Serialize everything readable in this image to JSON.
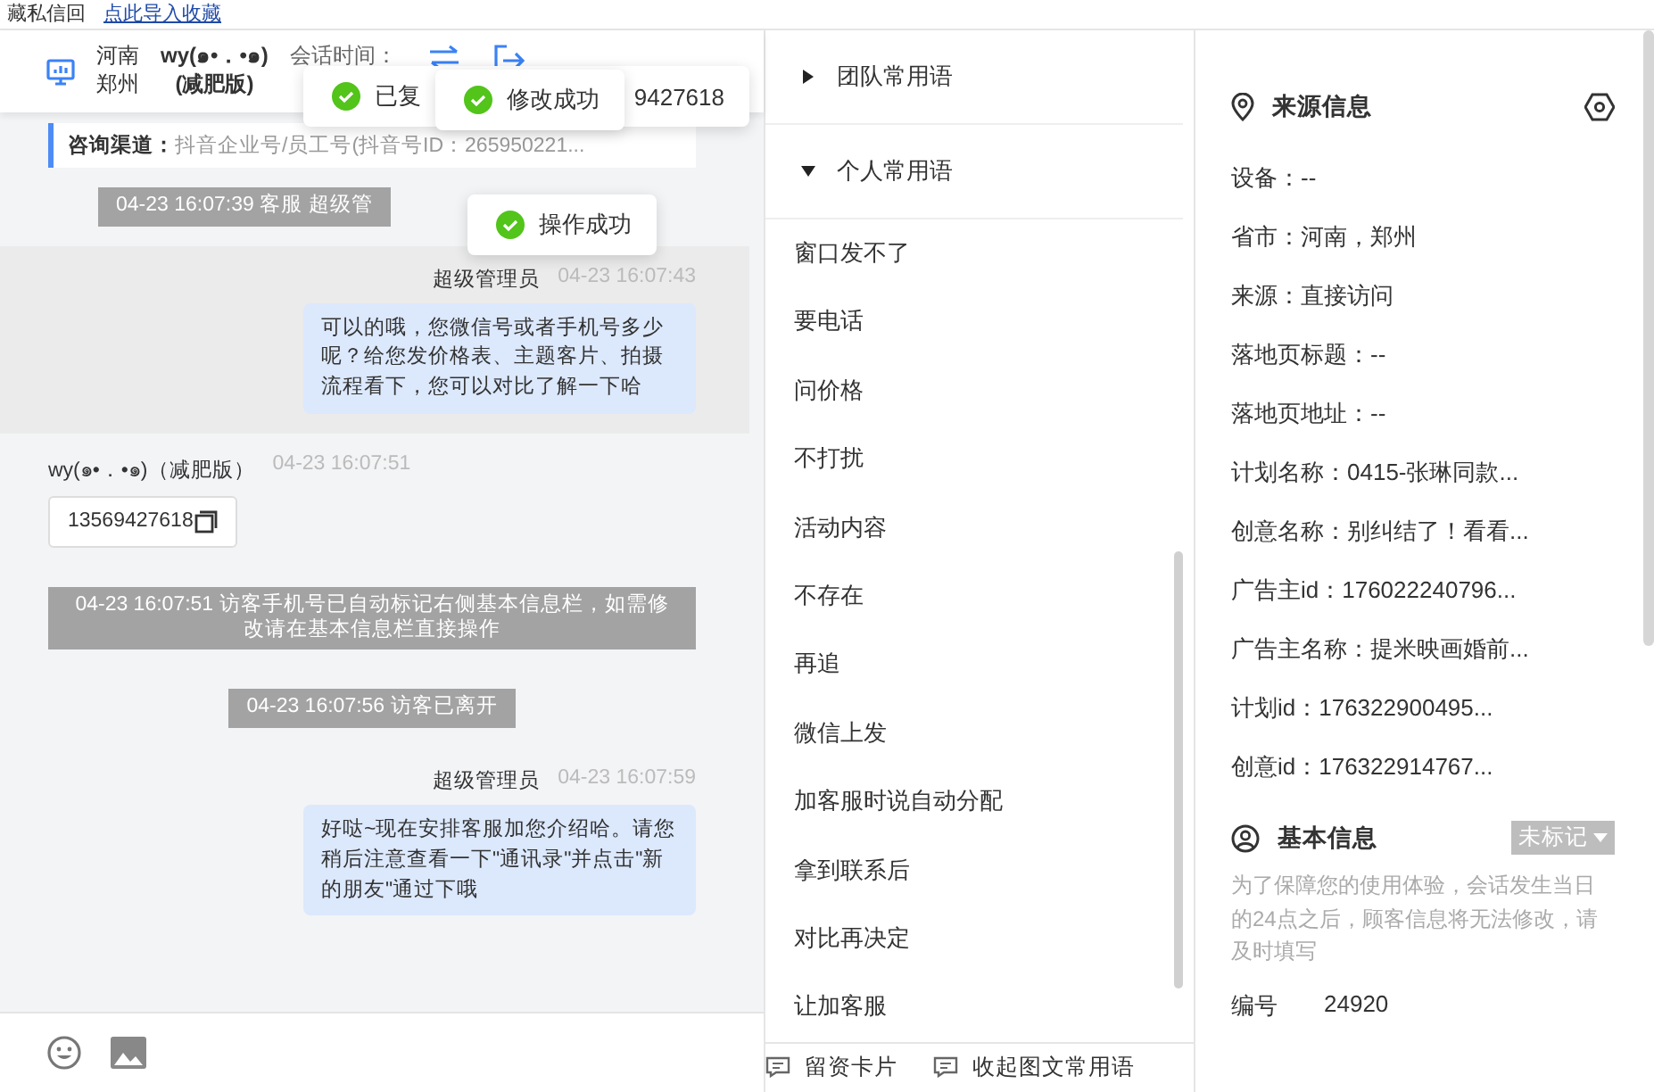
{
  "top_bar": {
    "text": "藏私信回",
    "link": "点此导入收藏"
  },
  "header": {
    "province": "河南",
    "city": "郑州",
    "visitor_name": "wy(๑•．•๑)",
    "visitor_tag": "(减肥版)",
    "session_label": "会话时间："
  },
  "toasts": [
    {
      "parts": [
        "已复",
        "9427618"
      ]
    },
    {
      "parts": [
        "修改成功"
      ]
    },
    {
      "parts": [
        "操作成功"
      ]
    }
  ],
  "channel": {
    "label": "咨询渠道：",
    "value": "抖音企业号/员工号(抖音号ID：265950221..."
  },
  "messages": [
    {
      "kind": "system",
      "highlighted": false,
      "text": "04-23 16:07:39 客服 超级管"
    },
    {
      "kind": "agent",
      "highlighted": true,
      "sender": "超级管理员",
      "time": "04-23 16:07:43",
      "text": "可以的哦，您微信号或者手机号多少呢？给您发价格表、主题客片、拍摄流程看下，您可以对比了解一下哈"
    },
    {
      "kind": "visitor",
      "highlighted": false,
      "sender": "wy(๑•．•๑)（减肥版）",
      "time": "04-23 16:07:51",
      "phone": "13569427618"
    },
    {
      "kind": "system",
      "highlighted": false,
      "text": "04-23 16:07:51 访客手机号已自动标记右侧基本信息栏，如需修改请在基本信息栏直接操作"
    },
    {
      "kind": "system",
      "highlighted": false,
      "text": "04-23 16:07:56 访客已离开"
    },
    {
      "kind": "agent",
      "highlighted": false,
      "sender": "超级管理员",
      "time": "04-23 16:07:59",
      "text": "好哒~现在安排客服加您介绍哈。请您稍后注意查看一下\"通讯录\"并点击\"新的朋友\"通过下哦"
    }
  ],
  "phrase_groups": [
    {
      "title": "团队常用语",
      "expanded": false
    },
    {
      "title": "个人常用语",
      "expanded": true,
      "items": [
        "窗口发不了",
        "要电话",
        "问价格",
        "不打扰",
        "活动内容",
        "不存在",
        "再追",
        "微信上发",
        "加客服时说自动分配",
        "拿到联系后",
        "对比再决定",
        "让加客服"
      ]
    }
  ],
  "footer_buttons": [
    "留资卡片",
    "收起图文常用语"
  ],
  "source_info": {
    "title": "来源信息",
    "fields": [
      "设备：--",
      "省市：河南，郑州",
      "来源：直接访问",
      "落地页标题：--",
      "落地页地址：--",
      "计划名称：0415-张琳同款...",
      "创意名称：别纠结了！看看...",
      "广告主id：176022240796...",
      "广告主名称：提米映画婚前...",
      "计划id：176322900495...",
      "创意id：176322914767..."
    ]
  },
  "basic_info": {
    "title": "基本信息",
    "tag": "未标记",
    "note": "为了保障您的使用体验，会话发生当日的24点之后，顾客信息将无法修改，请及时填写",
    "fields": [
      {
        "label": "编号",
        "value": "24920"
      }
    ]
  }
}
